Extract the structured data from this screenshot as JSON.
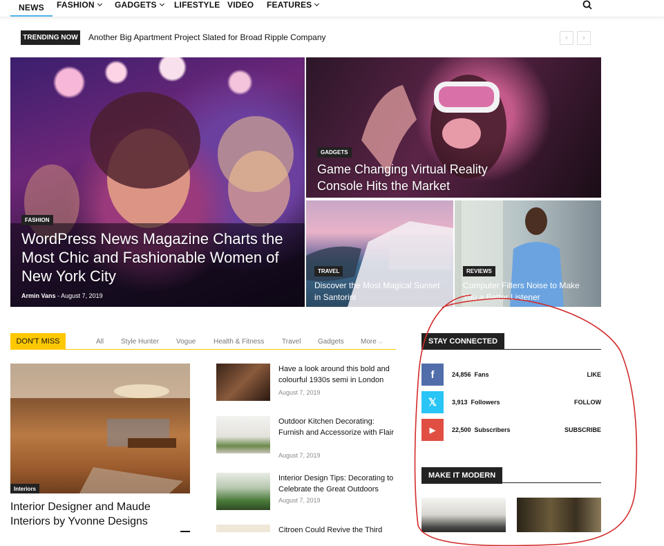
{
  "nav": {
    "items": [
      {
        "label": "NEWS",
        "has_dropdown": false
      },
      {
        "label": "FASHION",
        "has_dropdown": true
      },
      {
        "label": "GADGETS",
        "has_dropdown": true
      },
      {
        "label": "LIFESTYLE",
        "has_dropdown": false
      },
      {
        "label": "VIDEO",
        "has_dropdown": false
      },
      {
        "label": "FEATURES",
        "has_dropdown": true
      }
    ],
    "search_icon": "search-icon"
  },
  "trending": {
    "tag": "TRENDING NOW",
    "headline": "Another Big Apartment Project Slated for Broad Ripple Company",
    "prev": "‹",
    "next": "›"
  },
  "featured": {
    "main": {
      "category": "FASHION",
      "title": "WordPress News Magazine Charts the Most Chic and Fashionable Women of New York City",
      "author": "Armin Vans",
      "separator": "-",
      "date": "August 7, 2019"
    },
    "top_right": {
      "category": "GADGETS",
      "title": "Game Changing Virtual Reality Console Hits the Market"
    },
    "bottom_left": {
      "category": "TRAVEL",
      "title": "Discover the Most Magical Sunset in Santorini"
    },
    "bottom_right": {
      "category": "REVIEWS",
      "title": "Computer Filters Noise to Make You a Better Listener"
    }
  },
  "dont_miss": {
    "tag": "DON'T MISS",
    "tabs": [
      "All",
      "Style Hunter",
      "Vogue",
      "Health & Fitness",
      "Travel",
      "Gadgets",
      "More"
    ],
    "lead": {
      "category": "Interiors",
      "title": "Interior Designer and Maude Interiors by Yvonne Designs"
    },
    "items": [
      {
        "title": "Have a look around this bold and colourful 1930s semi in London",
        "date": "August 7, 2019"
      },
      {
        "title": "Outdoor Kitchen Decorating: Furnish and Accessorize with Flair",
        "date": "August 7, 2019"
      },
      {
        "title": "Interior Design Tips: Decorating to Celebrate the Great Outdoors",
        "date": "August 7, 2019"
      },
      {
        "title": "Citroen Could Revive the Third",
        "date": ""
      }
    ]
  },
  "stay_connected": {
    "tag": "STAY CONNECTED",
    "rows": [
      {
        "icon": "facebook-icon",
        "glyph": "f",
        "color": "#516eab",
        "count": "24,856",
        "label": "Fans",
        "action": "LIKE"
      },
      {
        "icon": "x-icon",
        "glyph": "𝕏",
        "color": "#29c5f6",
        "count": "3,913",
        "label": "Followers",
        "action": "FOLLOW"
      },
      {
        "icon": "youtube-icon",
        "glyph": "▶",
        "color": "#e14e42",
        "count": "22,500",
        "label": "Subscribers",
        "action": "SUBSCRIBE"
      }
    ]
  },
  "make_it_modern": {
    "tag": "MAKE IT MODERN"
  },
  "annotation": {
    "color": "#d22a2a"
  }
}
